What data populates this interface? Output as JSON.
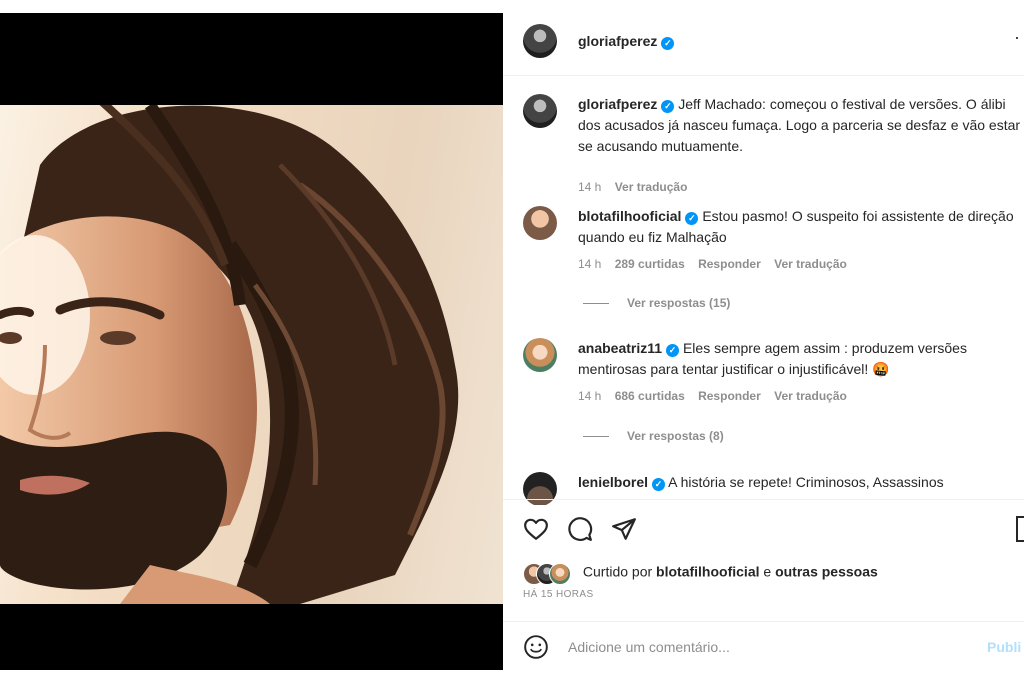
{
  "post": {
    "author": "gloriafperez"
  },
  "comments": [
    {
      "username": "gloriafperez",
      "text": "Jeff Machado: começou o festival de versões. O álibi dos acusados já nasceu fumaça. Logo a parceria se desfaz e vão estar se acusando mutuamente.",
      "time": "14 h",
      "translate": "Ver tradução"
    },
    {
      "username": "blotafilhooficial",
      "text": "Estou pasmo! O suspeito foi assistente de direção quando eu fiz Malhação",
      "time": "14 h",
      "likes": "289 curtidas",
      "reply": "Responder",
      "translate": "Ver tradução",
      "view_replies": "Ver respostas (15)"
    },
    {
      "username": "anabeatriz11",
      "text": "Eles sempre agem assim : produzem versões mentirosas para tentar justificar o injustificável! 🤬",
      "time": "14 h",
      "likes": "686 curtidas",
      "reply": "Responder",
      "translate": "Ver tradução",
      "view_replies": "Ver respostas (8)"
    },
    {
      "username": "lenielborel",
      "text": "A história se repete! Criminosos, Assassinos"
    }
  ],
  "likes": {
    "prefix": "Curtido por",
    "user": "blotafilhooficial",
    "connector": "e",
    "others": "outras pessoas"
  },
  "time_ago": "HÁ 15 HORAS",
  "add_comment": {
    "placeholder": "Adicione um comentário...",
    "publish": "Publi"
  },
  "icons": {
    "like": "heart-icon",
    "comment": "speech-bubble-icon",
    "share": "paper-plane-icon",
    "emoji": "smiley-icon"
  }
}
